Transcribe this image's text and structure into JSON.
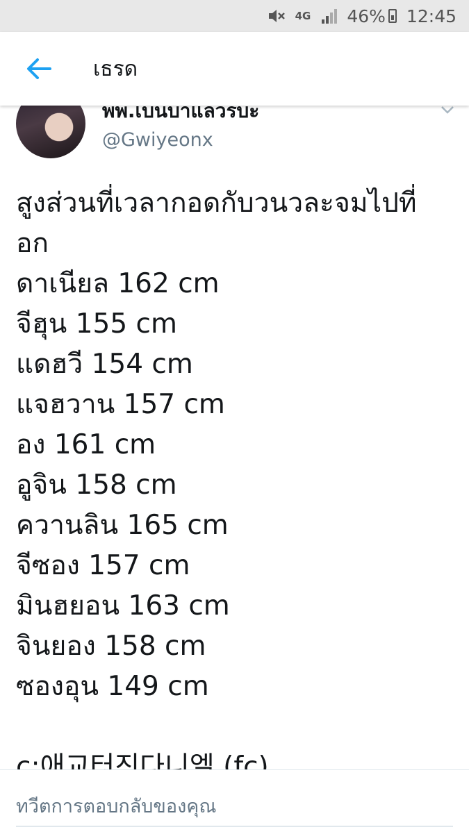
{
  "status_bar": {
    "network": "4G",
    "battery_percent": "46%",
    "time": "12:45"
  },
  "app_bar": {
    "title": "เธรด",
    "back_icon": "arrow-left-icon"
  },
  "tweet": {
    "display_name": "พพ.เบนบาแลวรบะ",
    "handle": "@Gwiyeonx",
    "lines": [
      "สูงส่วนที่เวลากอดกับวนวละจมไปที่",
      "อก",
      "ดาเนียล 162 cm",
      "จีฮุน 155 cm",
      "แดฮวี 154 cm",
      "แจฮวาน 157 cm",
      "อง 161 cm",
      "อูจิน 158 cm",
      "ควานลิน 165 cm",
      "จีซอง 157 cm",
      "มินฮยอน 163 cm",
      "จินยอง 158 cm",
      "ซองอุน 149 cm",
      "",
      "c:애교터진다니엘 (fc)"
    ]
  },
  "reply": {
    "placeholder": "ทวีตการตอบกลับของคุณ"
  },
  "colors": {
    "accent": "#1da1f2",
    "text": "#14171a",
    "secondary": "#657786",
    "status_bar_bg": "#e8e8e8"
  }
}
